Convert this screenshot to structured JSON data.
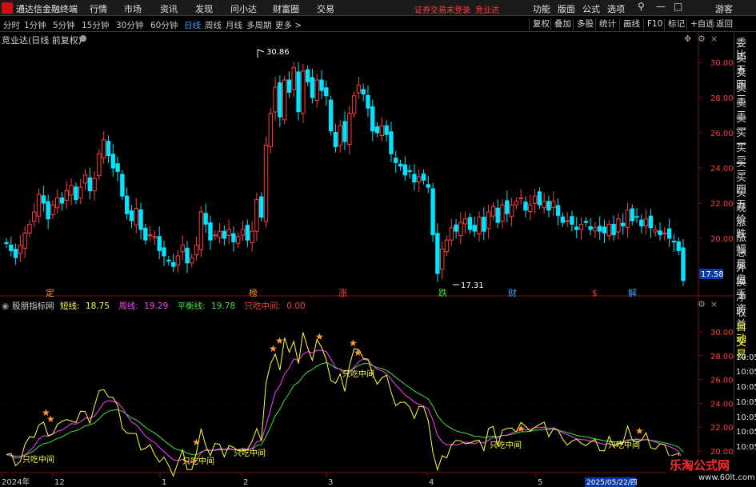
{
  "menubar": {
    "app_title": "通达信金融终端",
    "menus": [
      "行情",
      "市场",
      "资讯",
      "发现",
      "问小达",
      "财富圈",
      "交易"
    ],
    "notice": "证券交易未登录",
    "stock_name": "竞业达",
    "right_menus": [
      "功能",
      "版面",
      "公式",
      "选项"
    ],
    "user": "游客"
  },
  "period_bar": {
    "periods": [
      "分时",
      "1分钟",
      "5分钟",
      "15分钟",
      "30分钟",
      "60分钟",
      "日线",
      "周线",
      "月线",
      "多周期",
      "更多 >"
    ],
    "active": "日线",
    "tools": [
      "复权",
      "叠加",
      "多股",
      "统计",
      "画线",
      "F10",
      "标记",
      "+自选",
      "返回"
    ]
  },
  "main_chart": {
    "title": "竞业达(日线 前复权)",
    "y_ticks": [
      "30.00",
      "28.00",
      "26.00",
      "24.00",
      "22.00",
      "20.00"
    ],
    "current_price": "17.58",
    "high_label": "30.86",
    "low_label": "17.31",
    "event_markers": [
      "定",
      "榜",
      "涨",
      "跌",
      "财",
      "$",
      "解"
    ]
  },
  "right_panel": [
    "委比",
    "卖五",
    "卖四",
    "卖三",
    "卖二",
    "卖一",
    "买一",
    "买二",
    "买三",
    "买四",
    "买五",
    "现价",
    "涨跌",
    "涨幅",
    "总量",
    "外盘",
    "换手",
    "净资",
    "收益",
    "自动",
    "交易",
    "10:05",
    "10:05",
    "10:05",
    "10:05",
    "10:05",
    "10:05",
    "10:05",
    "10:05",
    "10:05"
  ],
  "indicator": {
    "name": "股朋指标网",
    "short_label": "短线:",
    "short_value": "18.75",
    "week_label": "周线:",
    "week_value": "19.29",
    "balance_label": "平衡线:",
    "balance_value": "19.78",
    "only_label": "只吃中间:",
    "only_value": "0.00",
    "y_ticks": [
      "30.00",
      "28.00",
      "26.00",
      "24.00",
      "22.00",
      "20.00"
    ],
    "signal_text": "只吃中间"
  },
  "timeline": {
    "labels": [
      "2024年",
      "12",
      "1",
      "2",
      "3",
      "4",
      "5"
    ],
    "cursor_date": "2025/05/22/四"
  },
  "watermark": {
    "title": "乐淘公式网",
    "url": "www.60lt.com"
  },
  "colors": {
    "up": "#ff3d3d",
    "down": "#00e5ff",
    "short_line": "#ffff40",
    "week_line": "#ff40ff",
    "balance_line": "#40e040",
    "active_blue": "#3fa0ff",
    "grid": "#7a1010"
  },
  "chart_data": [
    {
      "type": "candlestick",
      "title": "竞业达(日线 前复权)",
      "y_axis_ticks": [
        30.0,
        28.0,
        26.0,
        24.0,
        22.0,
        20.0
      ],
      "x_labels": [
        "2024年",
        "12",
        "1",
        "2",
        "3",
        "4",
        "5"
      ],
      "annotations": {
        "high": 30.86,
        "low": 17.31,
        "last": 17.58
      },
      "closes": [
        19.7,
        19.3,
        18.9,
        19.6,
        20.3,
        20.8,
        21.5,
        22.5,
        22.0,
        21.1,
        21.9,
        22.3,
        22.0,
        22.7,
        23.0,
        22.2,
        22.9,
        23.6,
        22.7,
        23.4,
        24.8,
        25.6,
        24.7,
        24.0,
        23.8,
        22.4,
        21.4,
        21.0,
        21.7,
        20.5,
        19.9,
        20.2,
        20.1,
        19.3,
        19.0,
        18.7,
        18.4,
        19.0,
        19.6,
        18.6,
        18.9,
        19.6,
        21.5,
        20.8,
        19.9,
        20.2,
        20.4,
        20.0,
        20.5,
        19.8,
        20.1,
        20.5,
        19.9,
        20.4,
        22.2,
        21.2,
        25.3,
        27.1,
        28.6,
        26.9,
        29.0,
        28.3,
        29.7,
        27.2,
        29.5,
        28.9,
        28.0,
        29.0,
        28.4,
        28.1,
        26.1,
        25.2,
        26.4,
        25.5,
        27.1,
        28.1,
        28.7,
        28.2,
        27.4,
        26.1,
        26.0,
        26.4,
        25.9,
        24.8,
        24.3,
        24.1,
        23.6,
        23.8,
        23.2,
        23.5,
        23.3,
        22.9,
        20.2,
        18.0,
        19.4,
        19.9,
        20.6,
        20.4,
        20.9,
        21.1,
        20.5,
        20.4,
        21.2,
        20.4,
        21.5,
        21.8,
        20.9,
        21.9,
        21.4,
        21.9,
        22.1,
        22.3,
        21.6,
        21.9,
        22.4,
        21.9,
        22.1,
        21.6,
        22.1,
        21.3,
        20.9,
        21.0,
        20.8,
        20.5,
        20.8,
        20.9,
        20.5,
        20.6,
        20.4,
        20.3,
        20.8,
        20.2,
        21.1,
        20.7,
        21.6,
        21.0,
        21.2,
        20.7,
        21.1,
        20.6,
        20.5,
        20.2,
        20.3,
        20.0,
        19.8,
        19.3,
        17.6
      ]
    },
    {
      "type": "line",
      "title": "股朋指标网",
      "y_axis_ticks": [
        30.0,
        28.0,
        26.0,
        24.0,
        22.0,
        20.0
      ],
      "series": [
        {
          "name": "短线",
          "last": 18.75
        },
        {
          "name": "周线",
          "last": 19.29
        },
        {
          "name": "平衡线",
          "last": 19.78
        },
        {
          "name": "只吃中间",
          "last": 0.0
        }
      ]
    }
  ]
}
